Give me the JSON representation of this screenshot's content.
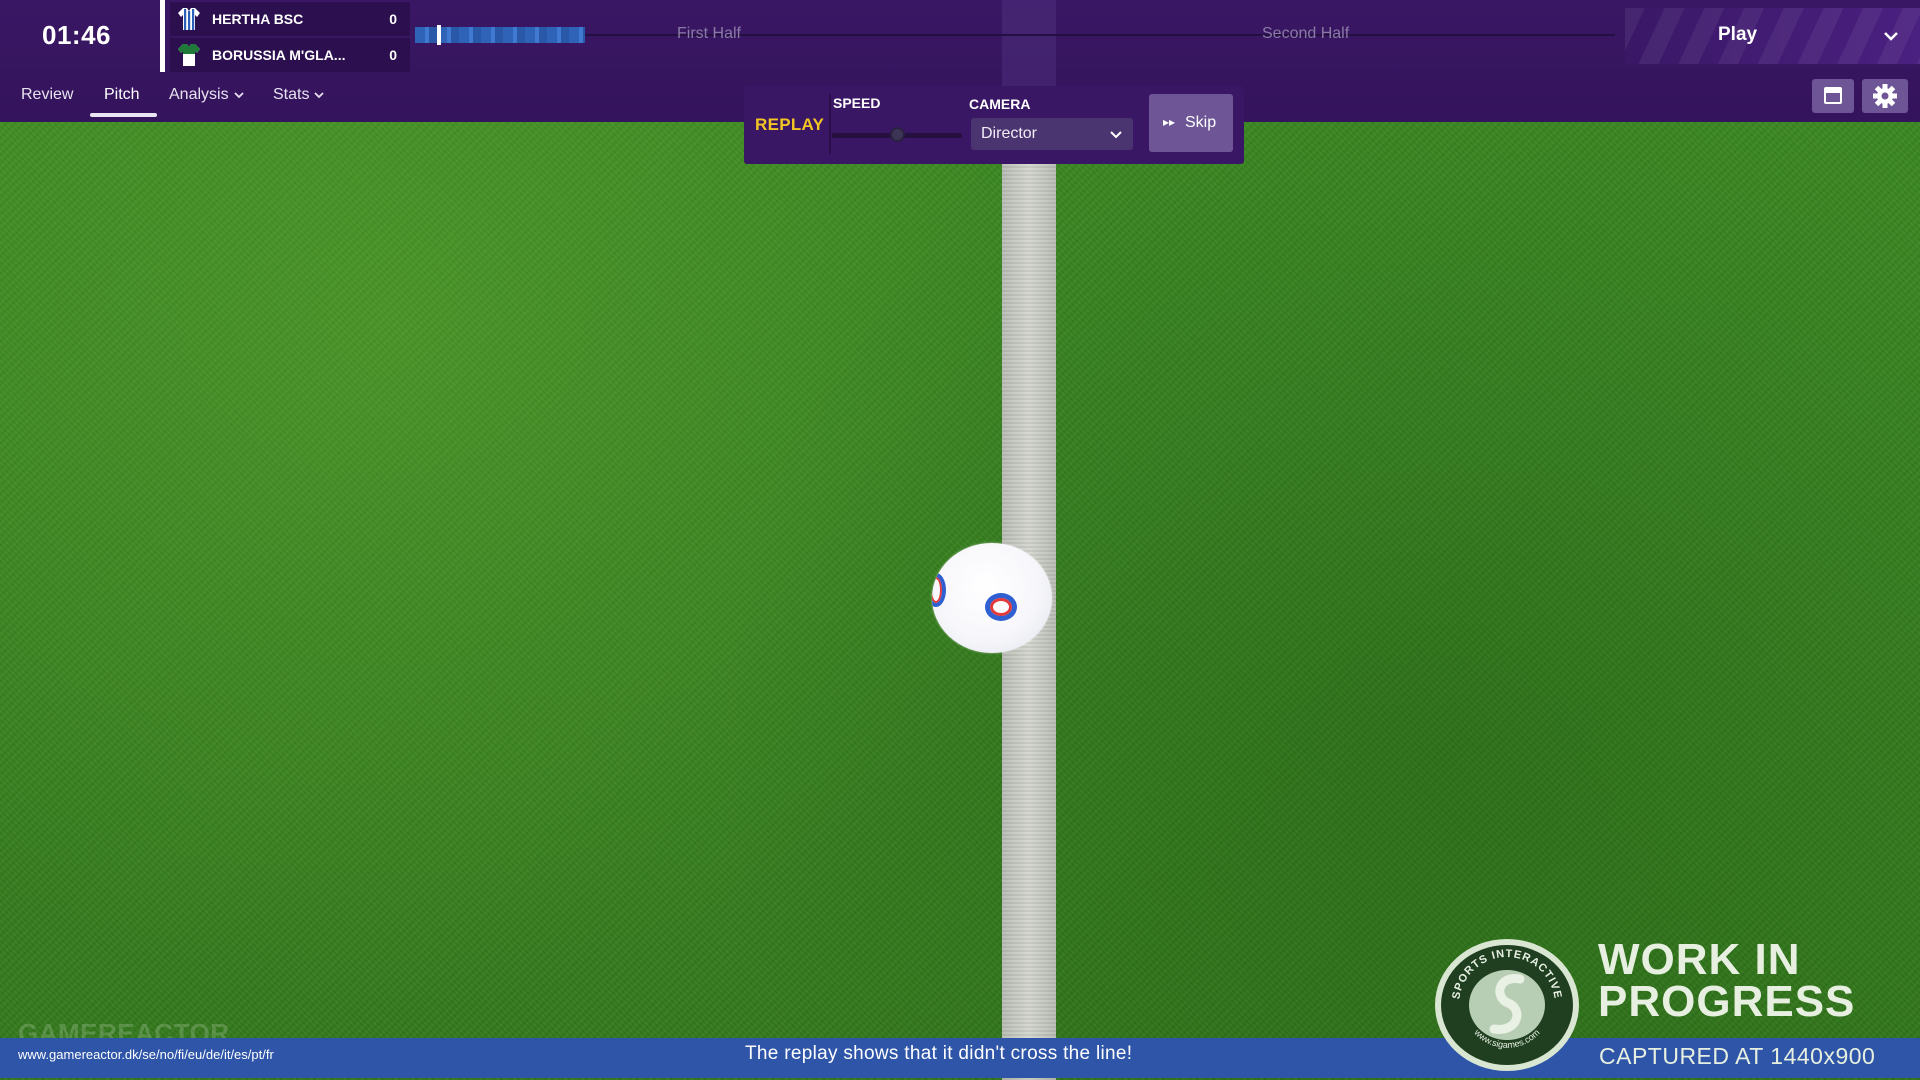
{
  "header": {
    "clock": "01:46",
    "home_team": {
      "name": "HERTHA BSC",
      "score": "0"
    },
    "away_team": {
      "name": "BORUSSIA M'GLA...",
      "score": "0"
    },
    "first_half_label": "First Half",
    "second_half_label": "Second Half",
    "play_label": "Play",
    "timeline_progress": 0.13
  },
  "nav": {
    "tabs": [
      {
        "label": "Review"
      },
      {
        "label": "Pitch",
        "active": true
      },
      {
        "label": "Analysis"
      },
      {
        "label": "Stats"
      }
    ]
  },
  "replay": {
    "title": "REPLAY",
    "speed_label": "SPEED",
    "camera_label": "CAMERA",
    "camera_value": "Director",
    "skip_label": "Skip",
    "speed_level": 0.45
  },
  "overlay": {
    "brand_watermark": "GAMEREACTOR",
    "url": "www.gamereactor.dk/se/no/fi/eu/de/it/es/pt/fr",
    "caption": "The replay shows that it didn't cross the line!",
    "wip_line1": "WORK IN",
    "wip_line2": "PROGRESS",
    "captured": "CAPTURED AT 1440x900",
    "seal_text": "SPORTS INTERACTIVE",
    "seal_url": "www.sigames.com"
  },
  "colors": {
    "header_bg": "#3a1764",
    "replay_accent": "#f2c522",
    "timeline_fill": "#2e63b8",
    "caption_bar": "#2e55a8",
    "pitch_green": "#3a8522"
  },
  "icons": {
    "home_kit": "striped-shirt-icon",
    "away_kit": "green-white-shirt-icon",
    "play_dropdown": "chevron-down-icon",
    "layout": "window-icon",
    "settings": "gear-icon",
    "skip": "fast-forward-icon"
  }
}
